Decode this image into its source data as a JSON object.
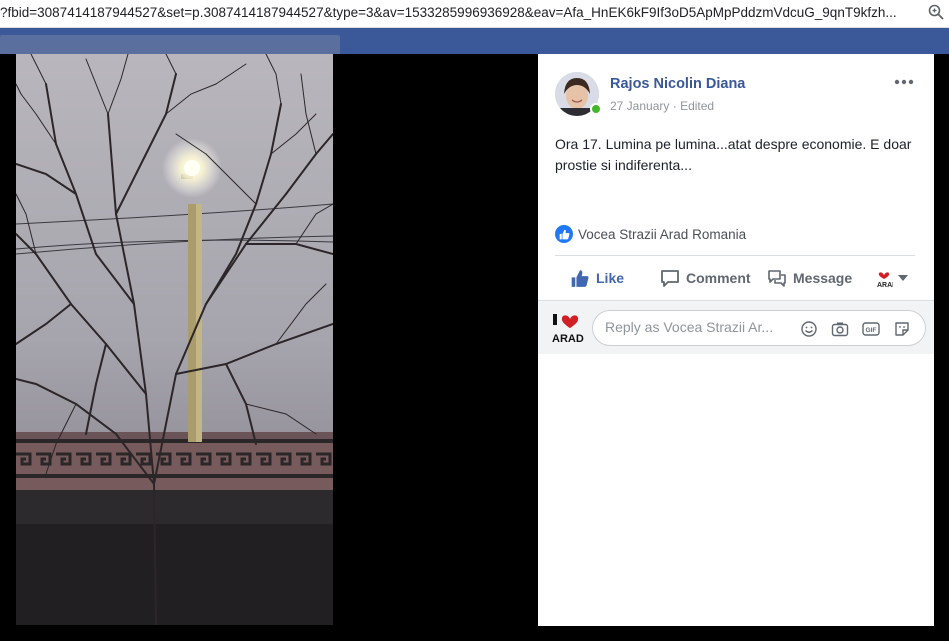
{
  "browser": {
    "url": "?fbid=3087414187944527&set=p.3087414187944527&type=3&av=1533285996936928&eav=Afa_HnEK6kF9If3oD5ApMpPddzmVdcuG_9qnT9kfzh..."
  },
  "post": {
    "author": "Rajos Nicolin Diana",
    "date": "27 January",
    "separator": "·",
    "edited": "Edited",
    "text": "Ora 17. Lumina pe lumina...atat despre economie. E doar prostie si indiferenta...",
    "liked_by_page": "Vocea Strazii Arad Romania"
  },
  "actions": {
    "like": "Like",
    "comment": "Comment",
    "message": "Message"
  },
  "reply": {
    "placeholder": "Reply as Vocea Strazii Ar..."
  },
  "colors": {
    "accent": "#4267b2",
    "author": "#385898",
    "online": "#42b72a",
    "brand_bar": "#3b5998"
  }
}
